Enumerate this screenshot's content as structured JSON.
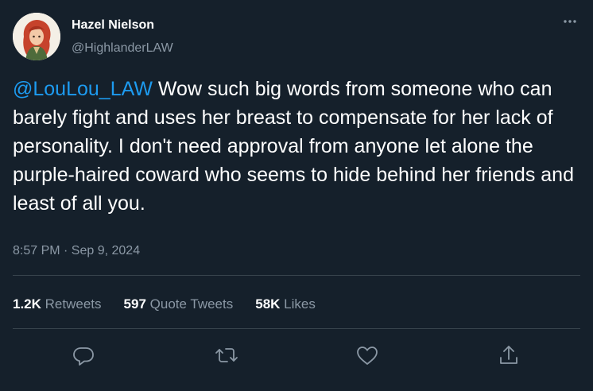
{
  "tweet": {
    "author_name": "Hazel Nielson",
    "author_handle": "@HighlanderLAW",
    "mention": "@LouLou_LAW",
    "text": " Wow such big words from someone who can barely fight and uses her breast to compensate for her lack of personality. I don't need approval from anyone let alone the purple-haired coward who seems to hide behind her friends and least of all you.",
    "timestamp": "8:57 PM · Sep 9, 2024"
  },
  "stats": {
    "retweets_count": "1.2K",
    "retweets_label": "Retweets",
    "quote_count": "597",
    "quote_label": "Quote Tweets",
    "likes_count": "58K",
    "likes_label": "Likes"
  },
  "icons": {
    "more": "more-icon",
    "reply": "reply-icon",
    "retweet": "retweet-icon",
    "like": "like-icon",
    "share": "share-icon"
  },
  "colors": {
    "background": "#15202b",
    "text": "#ffffff",
    "muted": "#8b98a5",
    "accent": "#1d9bf0",
    "divider": "#38444d"
  }
}
